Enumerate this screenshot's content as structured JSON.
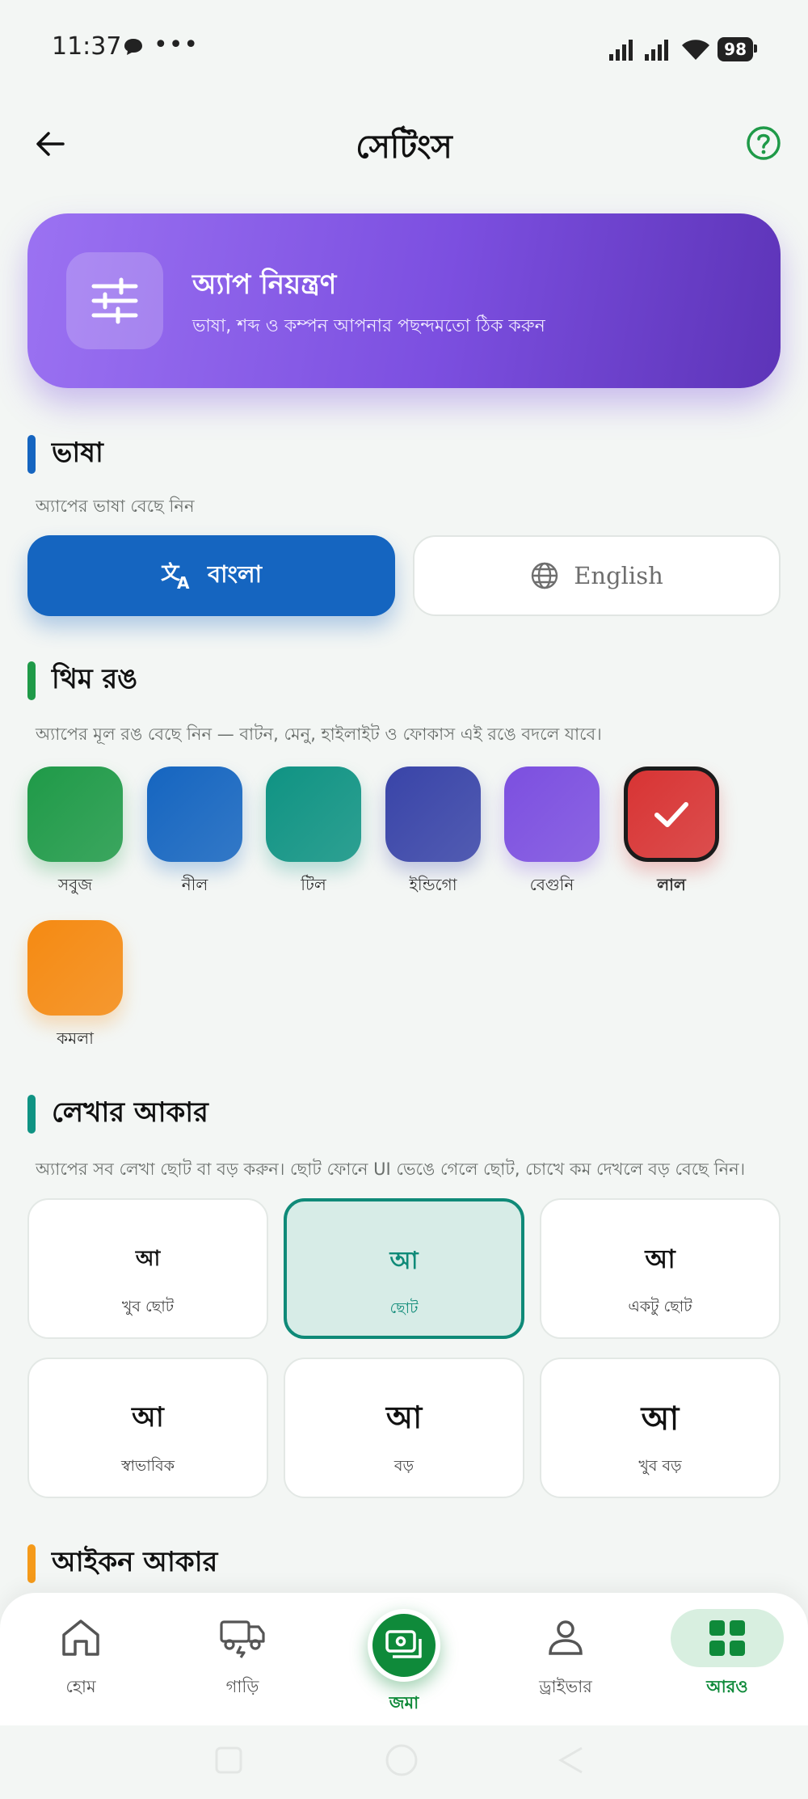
{
  "status_bar": {
    "time": "11:37",
    "dots": "•••",
    "battery": "98"
  },
  "header": {
    "title": "সেটিংস"
  },
  "hero": {
    "title": "অ্যাপ নিয়ন্ত্রণ",
    "subtitle": "ভাষা, শব্দ ও কম্পন আপনার পছন্দমতো ঠিক করুন"
  },
  "language": {
    "title": "ভাষা",
    "description": "অ্যাপের ভাষা বেছে নিন",
    "options": [
      {
        "label": "বাংলা",
        "selected": true
      },
      {
        "label": "English",
        "selected": false
      }
    ]
  },
  "theme": {
    "title": "থিম রঙ",
    "description": "অ্যাপের মূল রঙ বেছে নিন — বাটন, মেনু, হাইলাইট ও ফোকাস এই রঙে বদলে যাবে।",
    "colors": [
      {
        "label": "সবুজ",
        "color": "#1f9a48",
        "selected": false
      },
      {
        "label": "নীল",
        "color": "#1565c0",
        "selected": false
      },
      {
        "label": "টিল",
        "color": "#0f9383",
        "selected": false
      },
      {
        "label": "ইন্ডিগো",
        "color": "#3944a8",
        "selected": false
      },
      {
        "label": "বেগুনি",
        "color": "#7c4fe0",
        "selected": false
      },
      {
        "label": "লাল",
        "color": "#d83434",
        "selected": true
      },
      {
        "label": "কমলা",
        "color": "#f58a12",
        "selected": false
      }
    ]
  },
  "font_size": {
    "title": "লেখার আকার",
    "description": "অ্যাপের সব লেখা ছোট বা বড় করুন। ছোট ফোনে UI ভেঙে গেলে ছোট, চোখে কম দেখলে বড় বেছে নিন।",
    "glyph": "আ",
    "options": [
      {
        "label": "খুব ছোট",
        "selected": false
      },
      {
        "label": "ছোট",
        "selected": true
      },
      {
        "label": "একটু ছোট",
        "selected": false
      },
      {
        "label": "স্বাভাবিক",
        "selected": false
      },
      {
        "label": "বড়",
        "selected": false
      },
      {
        "label": "খুব বড়",
        "selected": false
      }
    ]
  },
  "icon_size": {
    "title": "আইকন আকার"
  },
  "bottom_nav": {
    "items": [
      {
        "label": "হোম",
        "icon": "home-icon"
      },
      {
        "label": "গাড়ি",
        "icon": "truck-icon"
      },
      {
        "label": "জমা",
        "icon": "cash-icon"
      },
      {
        "label": "ড্রাইভার",
        "icon": "person-icon"
      },
      {
        "label": "আরও",
        "icon": "grid-icon"
      }
    ]
  },
  "colors": {
    "accent": "#0f8a3a",
    "language_blue": "#1565c0",
    "hero_purple": "#7c4fe0",
    "teal": "#0f8a78"
  }
}
